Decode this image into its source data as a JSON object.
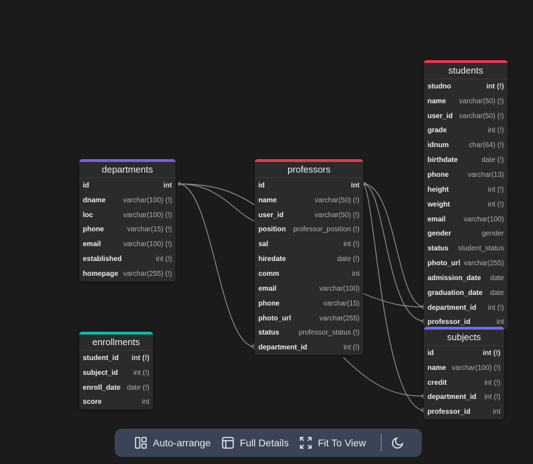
{
  "colors": {
    "departments": "#7b5cf0",
    "professors": "#e5384f",
    "students": "#e5384f",
    "enrollments": "#14b8a6",
    "subjects": "#6d6df0"
  },
  "tables": {
    "departments": {
      "title": "departments",
      "rows": [
        {
          "name": "id",
          "type": "int"
        },
        {
          "name": "dname",
          "type": "varchar(100) (!)"
        },
        {
          "name": "loc",
          "type": "varchar(100) (!)"
        },
        {
          "name": "phone",
          "type": "varchar(15) (!)"
        },
        {
          "name": "email",
          "type": "varchar(100) (!)"
        },
        {
          "name": "established",
          "type": "int (!)"
        },
        {
          "name": "homepage",
          "type": "varchar(255) (!)"
        }
      ]
    },
    "professors": {
      "title": "professors",
      "rows": [
        {
          "name": "id",
          "type": "int"
        },
        {
          "name": "name",
          "type": "varchar(50) (!)"
        },
        {
          "name": "user_id",
          "type": "varchar(50) (!)"
        },
        {
          "name": "position",
          "type": "professor_position (!)"
        },
        {
          "name": "sal",
          "type": "int (!)"
        },
        {
          "name": "hiredate",
          "type": "date (!)"
        },
        {
          "name": "comm",
          "type": "int"
        },
        {
          "name": "email",
          "type": "varchar(100)"
        },
        {
          "name": "phone",
          "type": "varchar(15)"
        },
        {
          "name": "photo_url",
          "type": "varchar(255)"
        },
        {
          "name": "status",
          "type": "professor_status (!)"
        },
        {
          "name": "department_id",
          "type": "int (!)"
        }
      ]
    },
    "students": {
      "title": "students",
      "rows": [
        {
          "name": "studno",
          "type": "int (!)"
        },
        {
          "name": "name",
          "type": "varchar(50) (!)"
        },
        {
          "name": "user_id",
          "type": "varchar(50) (!)"
        },
        {
          "name": "grade",
          "type": "int (!)"
        },
        {
          "name": "idnum",
          "type": "char(64) (!)"
        },
        {
          "name": "birthdate",
          "type": "date (!)"
        },
        {
          "name": "phone",
          "type": "varchar(13)"
        },
        {
          "name": "height",
          "type": "int (!)"
        },
        {
          "name": "weight",
          "type": "int (!)"
        },
        {
          "name": "email",
          "type": "varchar(100)"
        },
        {
          "name": "gender",
          "type": "gender"
        },
        {
          "name": "status",
          "type": "student_status"
        },
        {
          "name": "photo_url",
          "type": "varchar(255)"
        },
        {
          "name": "admission_date",
          "type": "date"
        },
        {
          "name": "graduation_date",
          "type": "date"
        },
        {
          "name": "department_id",
          "type": "int (!)"
        },
        {
          "name": "professor_id",
          "type": "int"
        }
      ]
    },
    "enrollments": {
      "title": "enrollments",
      "rows": [
        {
          "name": "student_id",
          "type": "int (!)"
        },
        {
          "name": "subject_id",
          "type": "int (!)"
        },
        {
          "name": "enroll_date",
          "type": "date (!)"
        },
        {
          "name": "score",
          "type": "int"
        }
      ]
    },
    "subjects": {
      "title": "subjects",
      "rows": [
        {
          "name": "id",
          "type": "int (!)"
        },
        {
          "name": "name",
          "type": "varchar(100) (!)"
        },
        {
          "name": "credit",
          "type": "int (!)"
        },
        {
          "name": "department_id",
          "type": "int (!)"
        },
        {
          "name": "professor_id",
          "type": "int"
        }
      ]
    }
  },
  "toolbar": {
    "auto_arrange": "Auto-arrange",
    "full_details": "Full Details",
    "fit_to_view": "Fit To View",
    "theme_icon": "moon-icon"
  }
}
